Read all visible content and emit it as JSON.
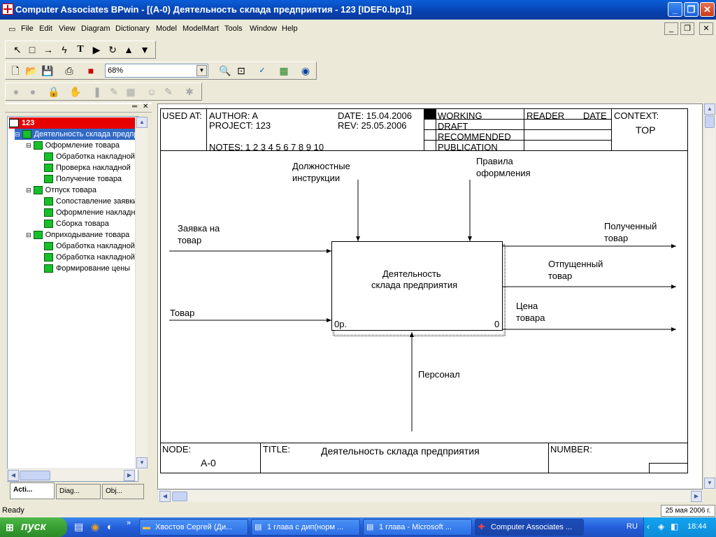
{
  "window": {
    "title": "Computer Associates BPwin - [(A-0) Деятельность  склада предприятия - 123  [IDEF0.bp1]]",
    "btn_min": "_",
    "btn_max": "❐",
    "btn_close": "✕"
  },
  "menu": {
    "items": [
      "File",
      "Edit",
      "View",
      "Diagram",
      "Dictionary",
      "Model",
      "ModelMart",
      "Tools",
      "Window",
      "Help"
    ],
    "mdi_min": "_",
    "mdi_restore": "❐",
    "mdi_close": "✕"
  },
  "toolbar": {
    "zoom_value": "68%",
    "tools": [
      "pointer",
      "box",
      "arrow",
      "squiggle",
      "text",
      "triangle-right",
      "rotate",
      "triangle-up",
      "triangle-down"
    ]
  },
  "tree": {
    "root": "123",
    "items": [
      {
        "label": "Деятельность  склада предприятия",
        "level": 1,
        "selected": true
      },
      {
        "label": "Оформление товара",
        "level": 2
      },
      {
        "label": "Обработка  накладной",
        "level": 3
      },
      {
        "label": "Проверка накладной",
        "level": 3
      },
      {
        "label": "Получение товара",
        "level": 3
      },
      {
        "label": "Отпуск товара",
        "level": 2
      },
      {
        "label": "Сопоставление заявки",
        "level": 3
      },
      {
        "label": "Оформление  накладной",
        "level": 3
      },
      {
        "label": "Сборка товара",
        "level": 3
      },
      {
        "label": "Оприходывание  товара",
        "level": 2
      },
      {
        "label": "Обработка накладной",
        "level": 3
      },
      {
        "label": "Обработка накладной",
        "level": 3
      },
      {
        "label": "Формирование цены",
        "level": 3
      }
    ],
    "tabs": [
      "Acti...",
      "Diag...",
      "Obj..."
    ]
  },
  "diagram": {
    "header": {
      "used_at": "USED AT:",
      "author": "AUTHOR:  A",
      "project": "PROJECT:  123",
      "date": "DATE:  15.04.2006",
      "rev": "REV:    25.05.2006",
      "notes": "NOTES:  1  2  3  4  5  6  7  8  9  10",
      "status": [
        "WORKING",
        "DRAFT",
        "RECOMMENDED",
        "PUBLICATION"
      ],
      "reader": "READER",
      "date_col": "DATE",
      "context": "CONTEXT:",
      "context_value": "TOP"
    },
    "box": {
      "line1": "Деятельность",
      "line2": "склада предприятия",
      "cost": "0р.",
      "number": "0"
    },
    "arrows": {
      "control1_l1": "Должностные",
      "control1_l2": "инструкции",
      "control2_l1": "Правила",
      "control2_l2": "оформления",
      "input1_l1": "Заявка на",
      "input1_l2": "товар",
      "input2": "Товар",
      "output1_l1": "Полученный",
      "output1_l2": "товар",
      "output2_l1": "Отпущенный",
      "output2_l2": "товар",
      "output3_l1": "Цена",
      "output3_l2": "товара",
      "mechanism": "Персонал"
    },
    "footer": {
      "node": "NODE:",
      "node_value": "A-0",
      "title": "TITLE:",
      "title_value": "Деятельность  склада предприятия",
      "number": "NUMBER:"
    }
  },
  "status": {
    "ready": "Ready",
    "date": "25 мая 2006 г."
  },
  "taskbar": {
    "start": "пуск",
    "tasks": [
      "Хвостов Сергей (Ди...",
      "1 глава с дип(норм ...",
      "1 глава - Microsoft ...",
      "Computer Associates ..."
    ],
    "lang": "RU",
    "time": "18:44"
  }
}
